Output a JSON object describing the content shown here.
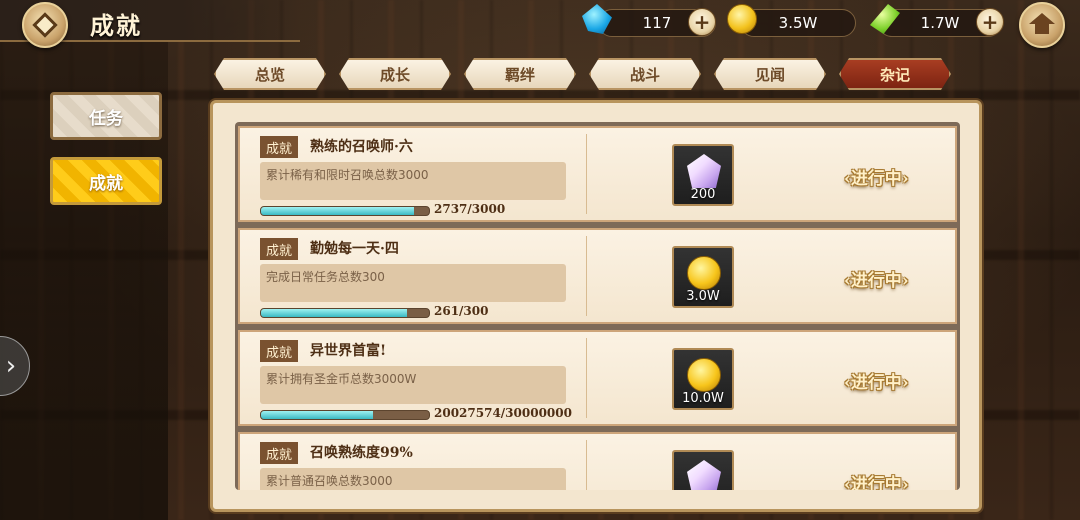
{
  "header": {
    "title": "成就",
    "currencies": [
      {
        "icon": "blue-gem-icon",
        "value": "117"
      },
      {
        "icon": "gold-coin-icon",
        "value": "3.5W"
      },
      {
        "icon": "green-leaf-icon",
        "value": "1.7W"
      }
    ]
  },
  "tabs": [
    {
      "label": "总览",
      "active": false
    },
    {
      "label": "成长",
      "active": false
    },
    {
      "label": "羁绊",
      "active": false
    },
    {
      "label": "战斗",
      "active": false
    },
    {
      "label": "见闻",
      "active": false
    },
    {
      "label": "杂记",
      "active": true
    }
  ],
  "side_buttons": [
    {
      "label": "任务",
      "active": false
    },
    {
      "label": "成就",
      "active": true
    }
  ],
  "achievements": [
    {
      "badge": "成就",
      "title": "熟练的召唤师·六",
      "description": "累计稀有和限时召唤总数3000",
      "progress_text": "2737/3000",
      "progress": 0.912,
      "reward_icon": "crystal-icon",
      "reward_amount": "200",
      "status": "进行中"
    },
    {
      "badge": "成就",
      "title": "勤勉每一天·四",
      "description": "完成日常任务总数300",
      "progress_text": "261/300",
      "progress": 0.87,
      "reward_icon": "gold-coin-icon",
      "reward_amount": "3.0W",
      "status": "进行中"
    },
    {
      "badge": "成就",
      "title": "异世界首富!",
      "description": "累计拥有圣金币总数3000W",
      "progress_text": "20027574/30000000",
      "progress": 0.667,
      "reward_icon": "gold-coin-icon",
      "reward_amount": "10.0W",
      "status": "进行中"
    },
    {
      "badge": "成就",
      "title": "召唤熟练度99%",
      "description": "累计普通召唤总数3000",
      "progress_text": "",
      "progress": null,
      "reward_icon": "crystal-icon",
      "reward_amount": "",
      "status": "进行中"
    }
  ],
  "colors": {
    "accent_tab": "#a83d22",
    "active_side": "#ffcc1a",
    "progress_fill": "#3ab9c3"
  }
}
